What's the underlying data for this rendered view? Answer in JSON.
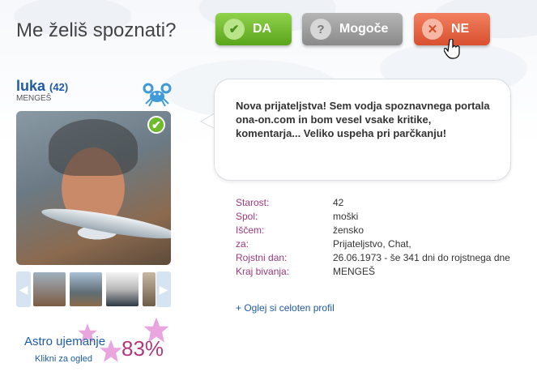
{
  "header": {
    "title": "Me želiš spoznati?"
  },
  "buttons": {
    "da": {
      "label": "DA",
      "icon": "check-icon",
      "color": "#6fba2c"
    },
    "mogoce": {
      "label": "Mogoče",
      "icon": "question-icon",
      "color": "#9a9a9a"
    },
    "ne": {
      "label": "NE",
      "icon": "x-icon",
      "color": "#e0583a"
    }
  },
  "profile": {
    "name": "luka",
    "age": "(42)",
    "city": "MENGEŠ",
    "zodiac_icon": "cancer-crab-icon",
    "verified_icon": "verified-check-icon"
  },
  "bubble": {
    "text": "Nova prijateljstva! Sem vodja spoznavnega portala ona-on.com in bom vesel vsake kritike, komentarja... Veliko uspeha pri parčkanju!"
  },
  "details": [
    {
      "label": "Starost:",
      "value": "42"
    },
    {
      "label": "Spol:",
      "value": "moški"
    },
    {
      "label": "Iščem:",
      "value": "žensko"
    },
    {
      "label": "za:",
      "value": "Prijateljstvo, Chat,"
    },
    {
      "label": "Rojstni dan:",
      "value": "26.06.1973 - še 341 dni do rojstnega dne"
    },
    {
      "label": "Kraj bivanja:",
      "value": "MENGEŠ"
    }
  ],
  "links": {
    "full_profile": "+ Oglej si celoten profil"
  },
  "astro": {
    "label": "Astro ujemanje",
    "sub": "Klikni za ogled",
    "percent": "83%",
    "star_color": "#e9a6de"
  }
}
